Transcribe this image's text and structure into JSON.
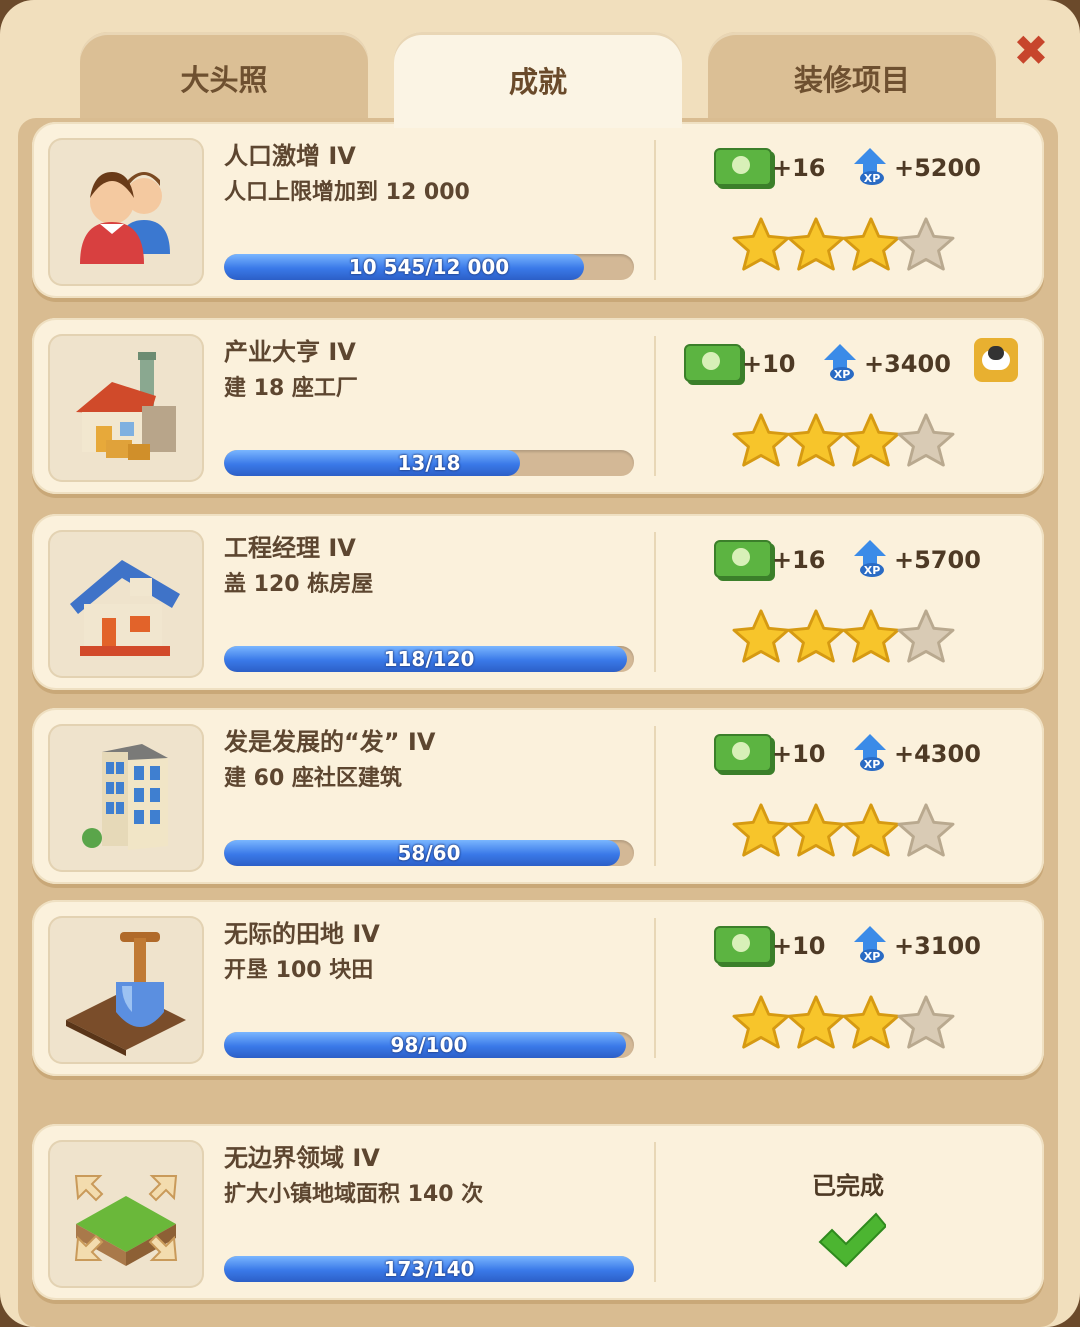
{
  "tabs": [
    {
      "label": "大头照",
      "active": false
    },
    {
      "label": "成就",
      "active": true
    },
    {
      "label": "装修项目",
      "active": false
    }
  ],
  "close_icon": "close-icon",
  "colors": {
    "progress": "#3a79e8",
    "star_filled": "#f7c52b",
    "star_empty": "#d9cbb5",
    "cash": "#5cb441",
    "xp": "#3b8be8",
    "check": "#4cb531"
  },
  "achievements": [
    {
      "icon": "people-icon",
      "title": "人口激增 IV",
      "desc": "人口上限增加到 12 000",
      "progress_text": "10 545/12 000",
      "progress": 0.8788,
      "cash": "+16",
      "xp": "+5200",
      "stars_filled": 3,
      "stars_total": 4,
      "extra_icon": ""
    },
    {
      "icon": "factory-icon",
      "title": "产业大亨 IV",
      "desc": "建 18 座工厂",
      "progress_text": "13/18",
      "progress": 0.7222,
      "cash": "+10",
      "xp": "+3400",
      "stars_filled": 3,
      "stars_total": 4,
      "extra_icon": "sheep-icon"
    },
    {
      "icon": "house-icon",
      "title": "工程经理 IV",
      "desc": "盖 120 栋房屋",
      "progress_text": "118/120",
      "progress": 0.9833,
      "cash": "+16",
      "xp": "+5700",
      "stars_filled": 3,
      "stars_total": 4,
      "extra_icon": ""
    },
    {
      "icon": "building-icon",
      "title": "发是发展的“发” IV",
      "desc": "建 60 座社区建筑",
      "progress_text": "58/60",
      "progress": 0.9667,
      "cash": "+10",
      "xp": "+4300",
      "stars_filled": 3,
      "stars_total": 4,
      "extra_icon": ""
    },
    {
      "icon": "shovel-icon",
      "title": "无际的田地 IV",
      "desc": "开垦 100 块田",
      "progress_text": "98/100",
      "progress": 0.98,
      "cash": "+10",
      "xp": "+3100",
      "stars_filled": 3,
      "stars_total": 4,
      "extra_icon": ""
    },
    {
      "icon": "expand-icon",
      "title": "无边界领域 IV",
      "desc": "扩大小镇地域面积 140 次",
      "progress_text": "173/140",
      "progress": 1.0,
      "completed": true,
      "completed_label": "已完成"
    }
  ]
}
